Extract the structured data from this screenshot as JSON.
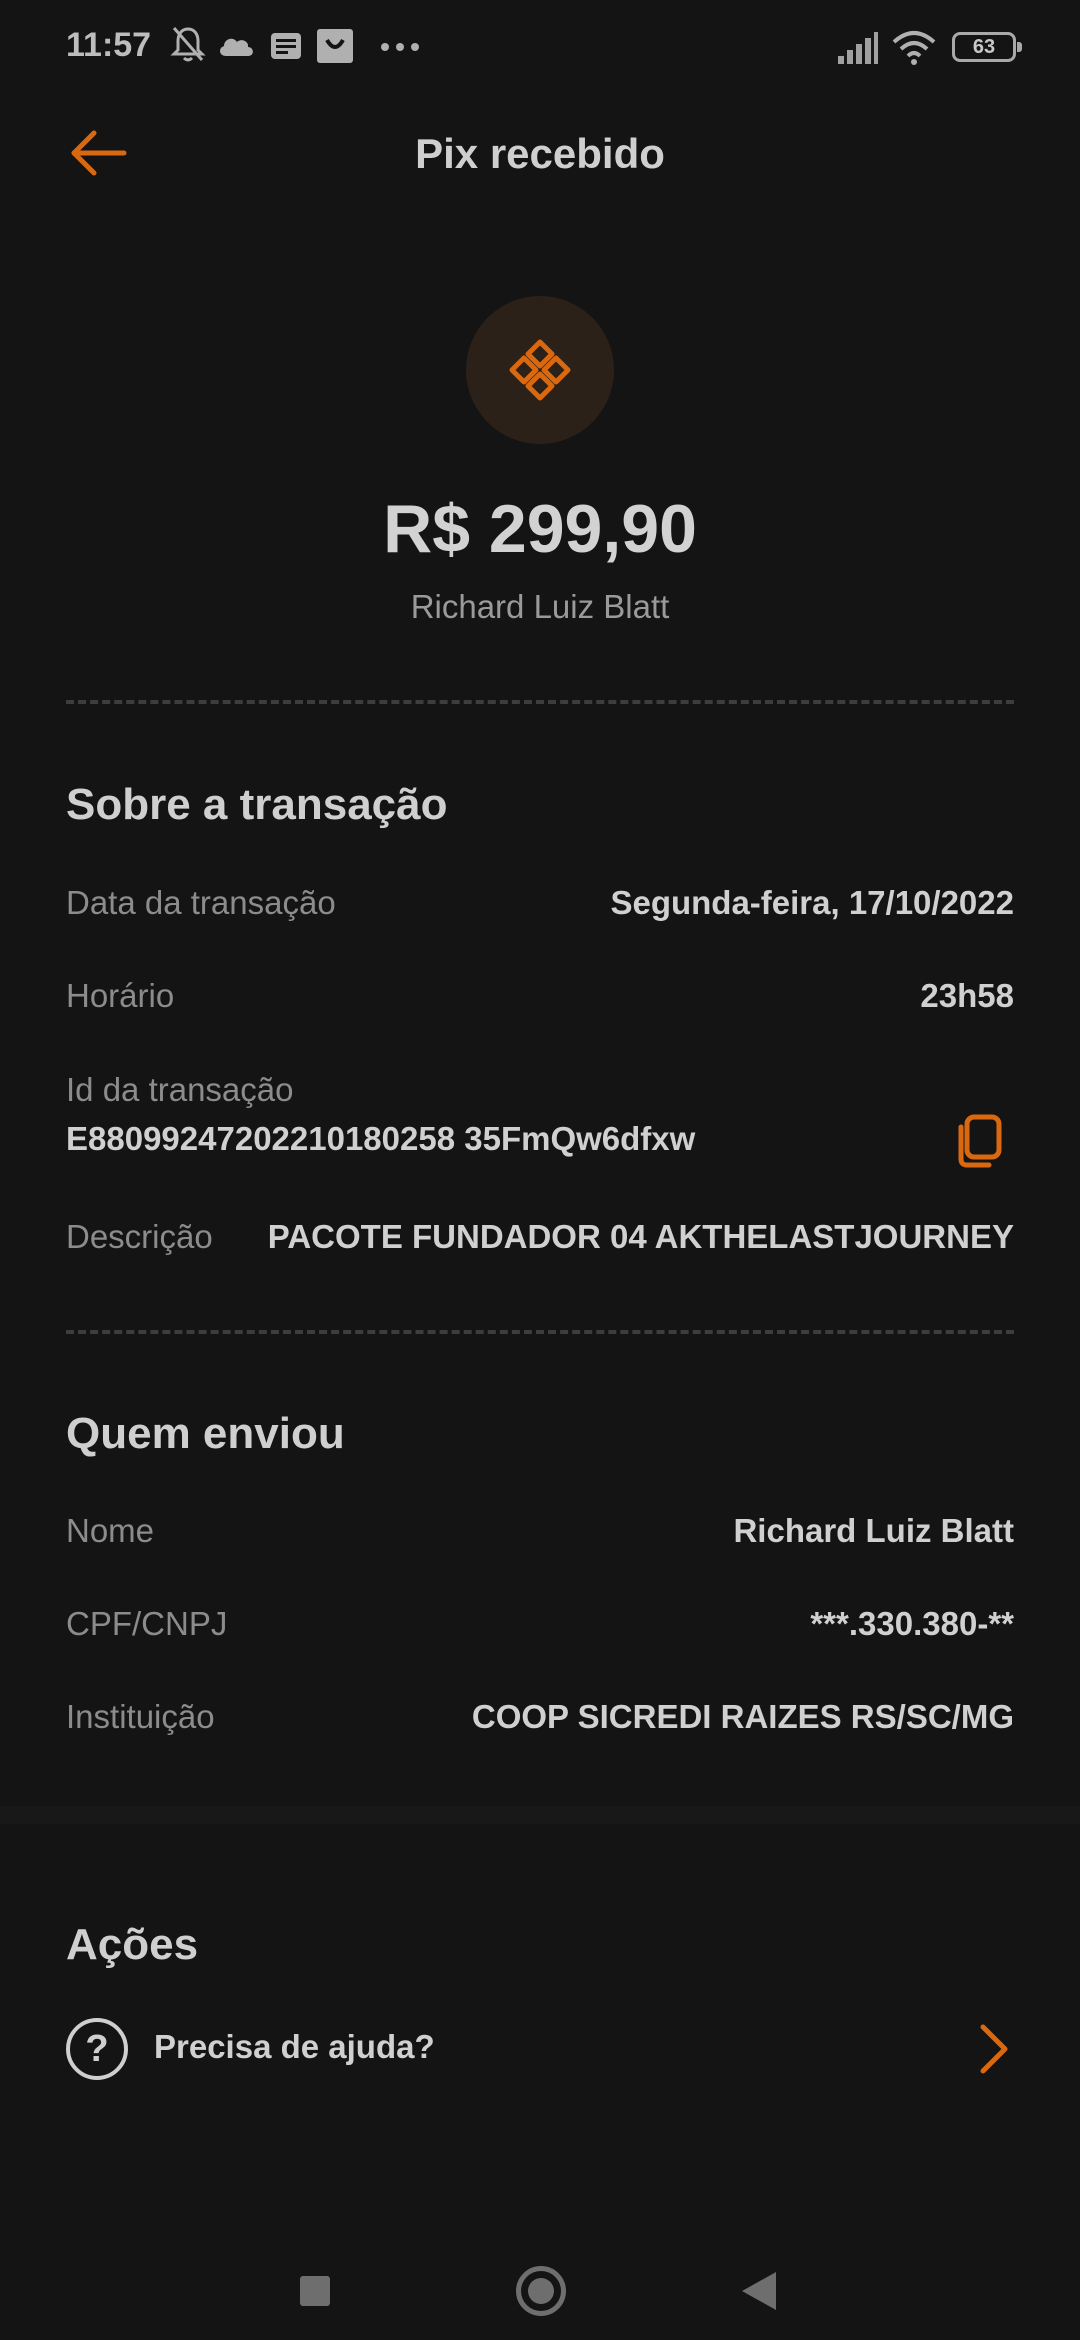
{
  "status_bar": {
    "time": "11:57",
    "icons": [
      "bell-off-icon",
      "cloud-icon",
      "news-icon",
      "bag-icon",
      "more-dots-icon"
    ],
    "battery": "63"
  },
  "header": {
    "title": "Pix recebido",
    "back_icon": "arrow-left-icon"
  },
  "hero": {
    "icon": "pix-logo-icon",
    "amount": "R$ 299,90",
    "sender": "Richard Luiz Blatt"
  },
  "transaction": {
    "title": "Sobre a transação",
    "date_label": "Data da transação",
    "date_value": "Segunda-feira, 17/10/2022",
    "time_label": "Horário",
    "time_value": "23h58",
    "id_label": "Id da transação",
    "id_value": "E88099247202210180258 35FmQw6dfxw",
    "description_label": "Descrição",
    "description_value": "PACOTE FUNDADOR 04 AKTHELASTJOURNEY"
  },
  "sender_section": {
    "title": "Quem enviou",
    "name_label": "Nome",
    "name_value": "Richard Luiz Blatt",
    "doc_label": "CPF/CNPJ",
    "doc_value": "***.330.380-**",
    "institution_label": "Instituição",
    "institution_value": "COOP SICREDI RAIZES RS/SC/MG"
  },
  "actions": {
    "title": "Ações",
    "help_label": "Precisa de ajuda?"
  },
  "colors": {
    "accent": "#d9680f",
    "background": "#141414"
  }
}
